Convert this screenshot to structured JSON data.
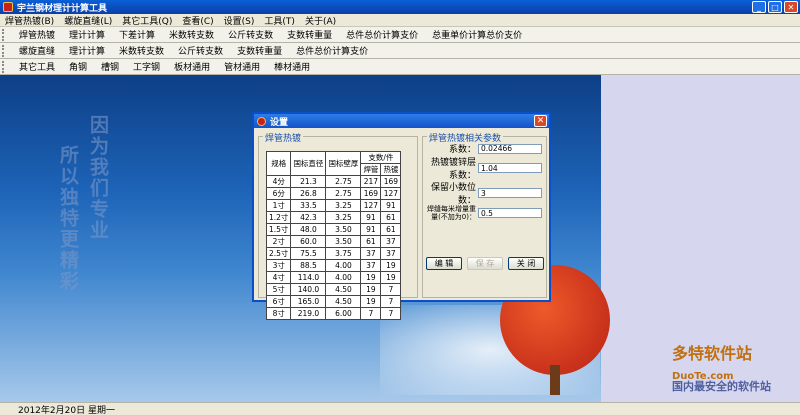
{
  "app": {
    "title": "宇兰钢材理计计算工具",
    "min": "_",
    "max": "□",
    "close": "✕"
  },
  "menu": [
    "焊管热镀(B)",
    "螺旋直缝(L)",
    "其它工具(Q)",
    "查看(C)",
    "设置(S)",
    "工具(T)",
    "关于(A)"
  ],
  "toolbar1": [
    "焊管热镀",
    "理计计算",
    "下差计算",
    "米数转支数",
    "公斤转支数",
    "支数转重量",
    "总件总价计算支价",
    "总重单价计算总价支价"
  ],
  "toolbar2": [
    "螺旋直缝",
    "理计计算",
    "米数转支数",
    "公斤转支数",
    "支数转重量",
    "总件总价计算支价"
  ],
  "toolbar3": [
    "其它工具",
    "角钢",
    "槽钢",
    "工字钢",
    "板材通用",
    "管材通用",
    "棒材通用"
  ],
  "desktop": {
    "deco1": "因为我们专业",
    "deco2": "所以独特更精彩",
    "watermark": "多特软件站",
    "watermark_url": "DuoTe.com",
    "watermark_sub": "国内最安全的软件站"
  },
  "status": {
    "date": "2012年2月20日  星期一"
  },
  "dialog": {
    "title": "设置",
    "close": "✕",
    "left_group": "焊管热镀",
    "table": {
      "h_spec": "规格",
      "h_dia": "国标直径",
      "h_wall": "国标壁厚",
      "h_count": "支数/件",
      "h_welded": "焊管",
      "h_galv": "热镀",
      "rows": [
        [
          "4分",
          "21.3",
          "2.75",
          "217",
          "169"
        ],
        [
          "6分",
          "26.8",
          "2.75",
          "169",
          "127"
        ],
        [
          "1寸",
          "33.5",
          "3.25",
          "127",
          "91"
        ],
        [
          "1.2寸",
          "42.3",
          "3.25",
          "91",
          "61"
        ],
        [
          "1.5寸",
          "48.0",
          "3.50",
          "91",
          "61"
        ],
        [
          "2寸",
          "60.0",
          "3.50",
          "61",
          "37"
        ],
        [
          "2.5寸",
          "75.5",
          "3.75",
          "37",
          "37"
        ],
        [
          "3寸",
          "88.5",
          "4.00",
          "37",
          "19"
        ],
        [
          "4寸",
          "114.0",
          "4.00",
          "19",
          "19"
        ],
        [
          "5寸",
          "140.0",
          "4.50",
          "19",
          "7"
        ],
        [
          "6寸",
          "165.0",
          "4.50",
          "19",
          "7"
        ],
        [
          "8寸",
          "219.0",
          "6.00",
          "7",
          "7"
        ]
      ]
    },
    "right_group": "焊管热镀相关参数",
    "coef_label": "系数：",
    "coef_value": "0.02466",
    "galv_label": "热镀镀锌层系数：",
    "galv_value": "1.04",
    "decimal_label": "保留小数位数：",
    "decimal_value": "3",
    "extra_label": "焊缝每米增量重量(不加为0)：",
    "extra_value": "0.5",
    "btn_edit": "编  辑",
    "btn_save": "保  存",
    "btn_close": "关  闭"
  }
}
